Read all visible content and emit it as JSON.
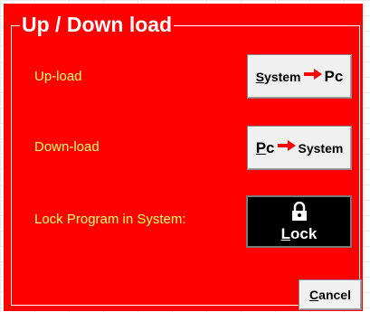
{
  "window": {
    "title": "Up / Down load"
  },
  "rows": {
    "upload_label": "Up-load",
    "download_label": "Down-load",
    "lock_label": "Lock Program in System:"
  },
  "buttons": {
    "upload": {
      "left": "System",
      "left_mnemonic": "S",
      "left_rest": "ystem",
      "right": "Pc"
    },
    "download": {
      "left": "Pc",
      "left_mnemonic": "P",
      "left_rest": "c",
      "right": "System"
    },
    "lock": {
      "label": "Lock",
      "mnemonic": "L",
      "rest": "ock"
    },
    "cancel": {
      "label": "Cancel",
      "mnemonic": "C",
      "rest": "ancel"
    }
  },
  "colors": {
    "panel": "#ff0000",
    "label_text": "#ffff66",
    "title_text": "#ffffff",
    "arrow": "#ff0000",
    "lock_bg": "#000000"
  },
  "icons": {
    "transfer_arrow": "right-arrow-icon",
    "lock": "padlock-icon"
  }
}
